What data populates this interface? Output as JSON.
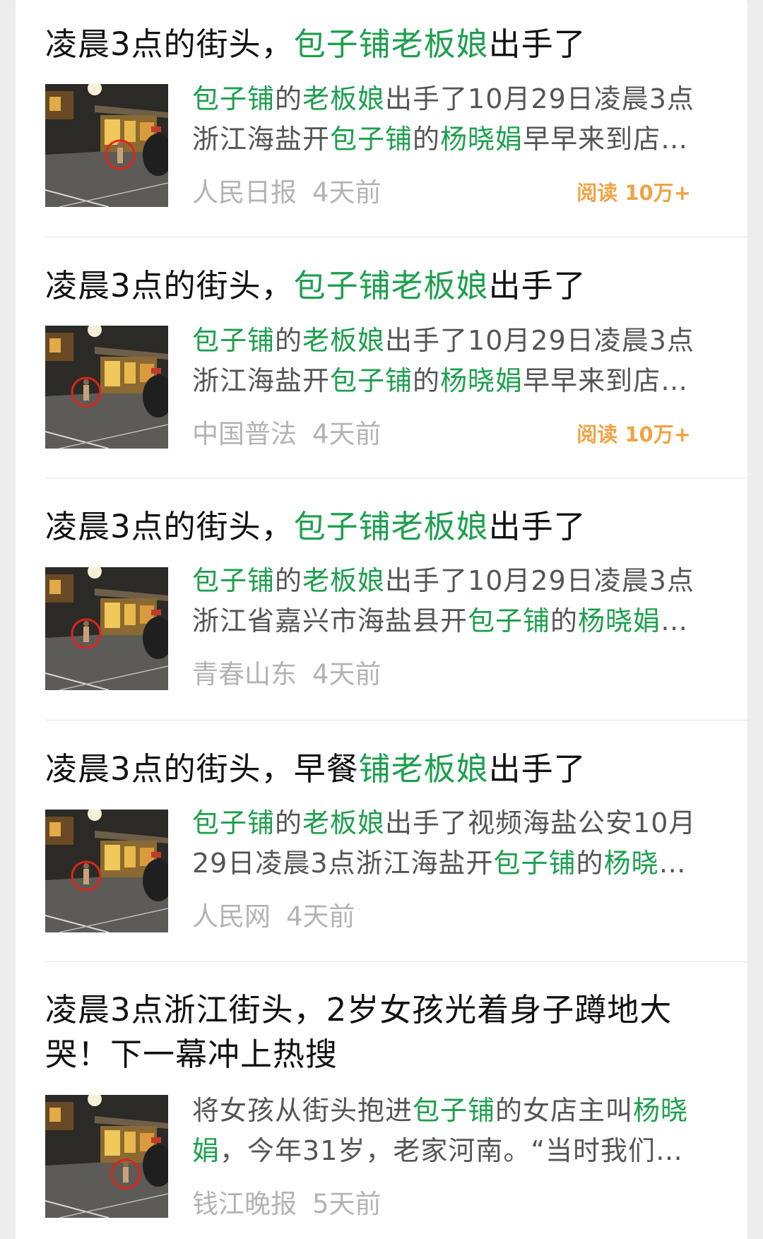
{
  "colors": {
    "highlight": "#1d9f4e",
    "reads": "#f0a344",
    "meta": "#b3b3b3"
  },
  "articles": [
    {
      "title": [
        {
          "t": "凌晨3点的街头，",
          "h": false
        },
        {
          "t": "包子铺老板娘",
          "h": true
        },
        {
          "t": "出手了",
          "h": false
        }
      ],
      "abstract": [
        [
          {
            "t": "包子铺",
            "h": true
          },
          {
            "t": "的",
            "h": false
          },
          {
            "t": "老板娘",
            "h": true
          },
          {
            "t": "出手了10月29日凌晨3点",
            "h": false
          }
        ],
        [
          {
            "t": "浙江海盐开",
            "h": false
          },
          {
            "t": "包子铺",
            "h": true
          },
          {
            "t": "的",
            "h": false
          },
          {
            "t": "杨晓娟",
            "h": true
          },
          {
            "t": "早早来到店…",
            "h": false
          }
        ]
      ],
      "source": "人民日报",
      "time": "4天前",
      "reads": "阅读 10万+"
    },
    {
      "title": [
        {
          "t": "凌晨3点的街头，",
          "h": false
        },
        {
          "t": "包子铺老板娘",
          "h": true
        },
        {
          "t": "出手了",
          "h": false
        }
      ],
      "abstract": [
        [
          {
            "t": "包子铺",
            "h": true
          },
          {
            "t": "的",
            "h": false
          },
          {
            "t": "老板娘",
            "h": true
          },
          {
            "t": "出手了10月29日凌晨3点",
            "h": false
          }
        ],
        [
          {
            "t": "浙江海盐开",
            "h": false
          },
          {
            "t": "包子铺",
            "h": true
          },
          {
            "t": "的",
            "h": false
          },
          {
            "t": "杨晓娟",
            "h": true
          },
          {
            "t": "早早来到店…",
            "h": false
          }
        ]
      ],
      "source": "中国普法",
      "time": "4天前",
      "reads": "阅读 10万+"
    },
    {
      "title": [
        {
          "t": "凌晨3点的街头，",
          "h": false
        },
        {
          "t": "包子铺老板娘",
          "h": true
        },
        {
          "t": "出手了",
          "h": false
        }
      ],
      "abstract": [
        [
          {
            "t": "包子铺",
            "h": true
          },
          {
            "t": "的",
            "h": false
          },
          {
            "t": "老板娘",
            "h": true
          },
          {
            "t": "出手了10月29日凌晨3点",
            "h": false
          }
        ],
        [
          {
            "t": "浙江省嘉兴市海盐县开",
            "h": false
          },
          {
            "t": "包子铺",
            "h": true
          },
          {
            "t": "的",
            "h": false
          },
          {
            "t": "杨晓娟",
            "h": true
          },
          {
            "t": "…",
            "h": false
          }
        ]
      ],
      "source": "青春山东",
      "time": "4天前",
      "reads": ""
    },
    {
      "title": [
        {
          "t": "凌晨3点的街头，早餐",
          "h": false
        },
        {
          "t": "铺老板娘",
          "h": true
        },
        {
          "t": "出手了",
          "h": false
        }
      ],
      "abstract": [
        [
          {
            "t": "包子铺",
            "h": true
          },
          {
            "t": "的",
            "h": false
          },
          {
            "t": "老板娘",
            "h": true
          },
          {
            "t": "出手了视频海盐公安10月",
            "h": false
          }
        ],
        [
          {
            "t": "29日凌晨3点浙江海盐开",
            "h": false
          },
          {
            "t": "包子铺",
            "h": true
          },
          {
            "t": "的",
            "h": false
          },
          {
            "t": "杨晓",
            "h": true
          },
          {
            "t": "…",
            "h": false
          }
        ]
      ],
      "source": "人民网",
      "time": "4天前",
      "reads": ""
    },
    {
      "title": [
        {
          "t": "凌晨3点浙江街头，2岁女孩光着身子蹲地大哭！下一幕冲上热搜",
          "h": false
        }
      ],
      "abstract": [
        [
          {
            "t": "将女孩从街头抱进",
            "h": false
          },
          {
            "t": "包子铺",
            "h": true
          },
          {
            "t": "的女店主叫",
            "h": false
          },
          {
            "t": "杨晓",
            "h": true
          }
        ],
        [
          {
            "t": "娟",
            "h": true
          },
          {
            "t": "，今年31岁，老家河南。“当时我们…",
            "h": false
          }
        ]
      ],
      "source": "钱江晚报",
      "time": "5天前",
      "reads": ""
    }
  ]
}
